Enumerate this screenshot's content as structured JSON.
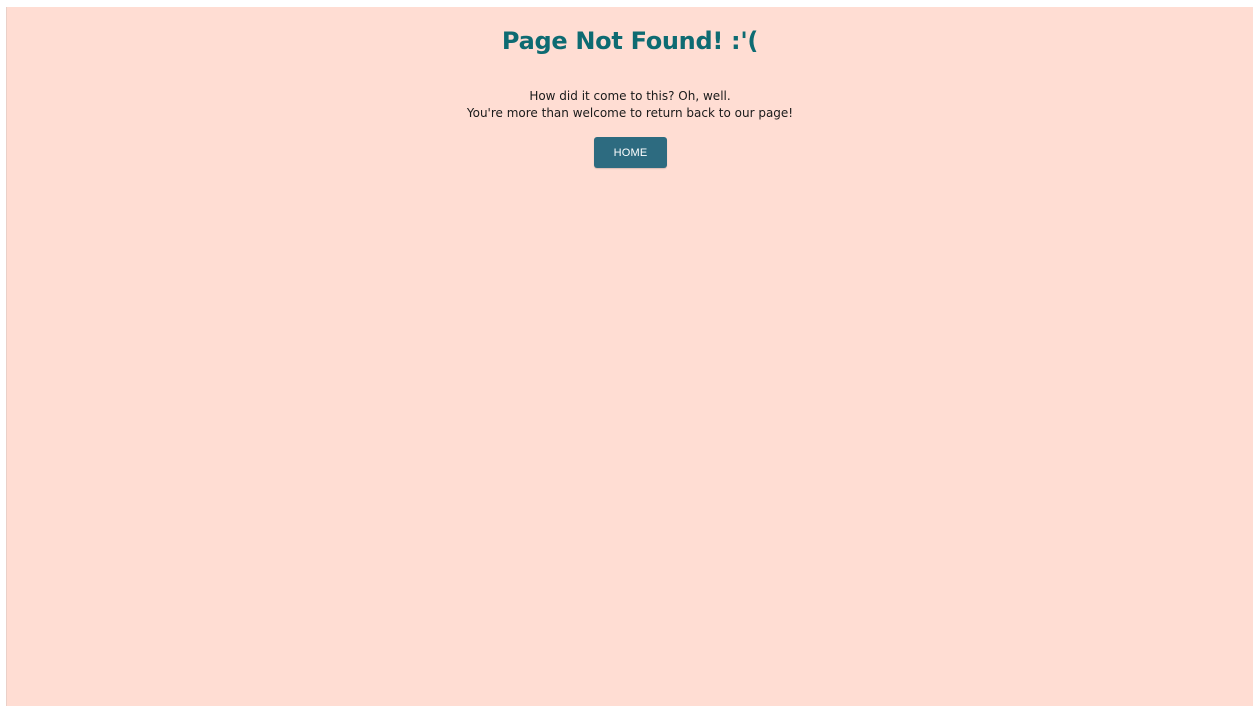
{
  "page": {
    "title": "Page Not Found! :'(",
    "message_line1": "How did it come to this? Oh, well.",
    "message_line2": "You're more than welcome to return back to our page!",
    "home_button_label": "HOME"
  },
  "colors": {
    "background": "#FFDDD3",
    "title": "#0E6B72",
    "button": "#2D6B80",
    "button_text": "#FFFFFF"
  }
}
